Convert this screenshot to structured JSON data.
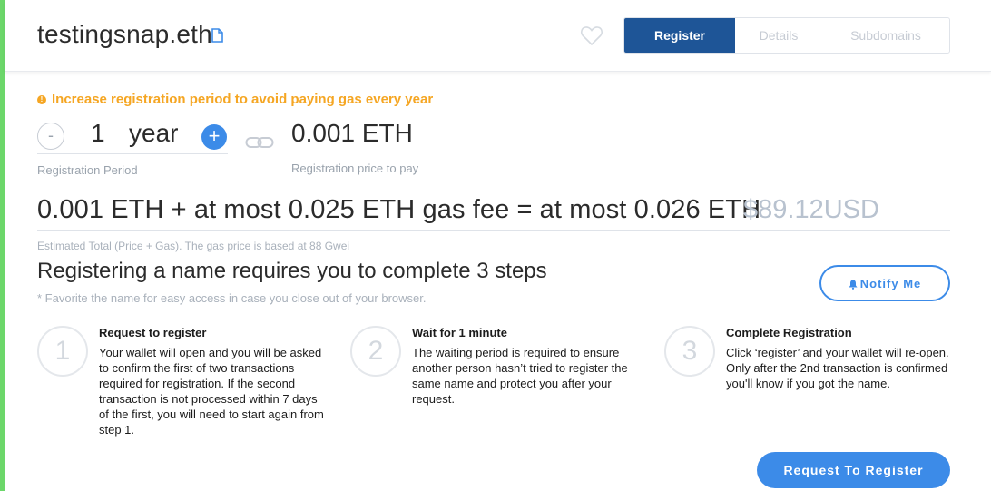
{
  "header": {
    "domain": "testingsnap.eth",
    "icons": {
      "copy": "document-icon",
      "favorite": "heart-icon"
    },
    "tabs": [
      {
        "label": "Register",
        "active": true
      },
      {
        "label": "Details",
        "active": false
      },
      {
        "label": "Subdomains",
        "active": false
      }
    ]
  },
  "warning": {
    "icon": "exclamation-icon",
    "text": "Increase registration period to avoid paying gas every year"
  },
  "period": {
    "decrement_label": "-",
    "value": "1",
    "unit": "year",
    "increment_label": "+",
    "label": "Registration Period"
  },
  "price": {
    "value": "0.001 ETH",
    "label": "Registration price to pay"
  },
  "total": {
    "text": "0.001 ETH + at most 0.025 ETH gas fee = at most 0.026 ETH",
    "usd": "$89.12USD",
    "label": "Estimated Total (Price + Gas). The gas price is based at 88 Gwei"
  },
  "steps_section": {
    "title": "Registering a name requires you to complete 3 steps",
    "note": "* Favorite the name for easy access in case you close out of your browser.",
    "notify_label": "Notify Me",
    "steps": [
      {
        "number": "1",
        "title": "Request to register",
        "description": "Your wallet will open and you will be asked to confirm the first of two transactions required for registration. If the second transaction is not processed within 7 days of the first, you will need to start again from step 1."
      },
      {
        "number": "2",
        "title": "Wait for 1 minute",
        "description": "The waiting period is required to ensure another person hasn’t tried to register the same name and protect you after your request."
      },
      {
        "number": "3",
        "title": "Complete Registration",
        "description": "Click ‘register’ and your wallet will re-open. Only after the 2nd transaction is confirmed you'll know if you got the name."
      }
    ]
  },
  "actions": {
    "request_label": "Request To Register"
  },
  "colors": {
    "accent": "#3c8be8",
    "tab_active": "#1e5597",
    "warning": "#f5a623",
    "status_bar": "#6cd76a"
  }
}
